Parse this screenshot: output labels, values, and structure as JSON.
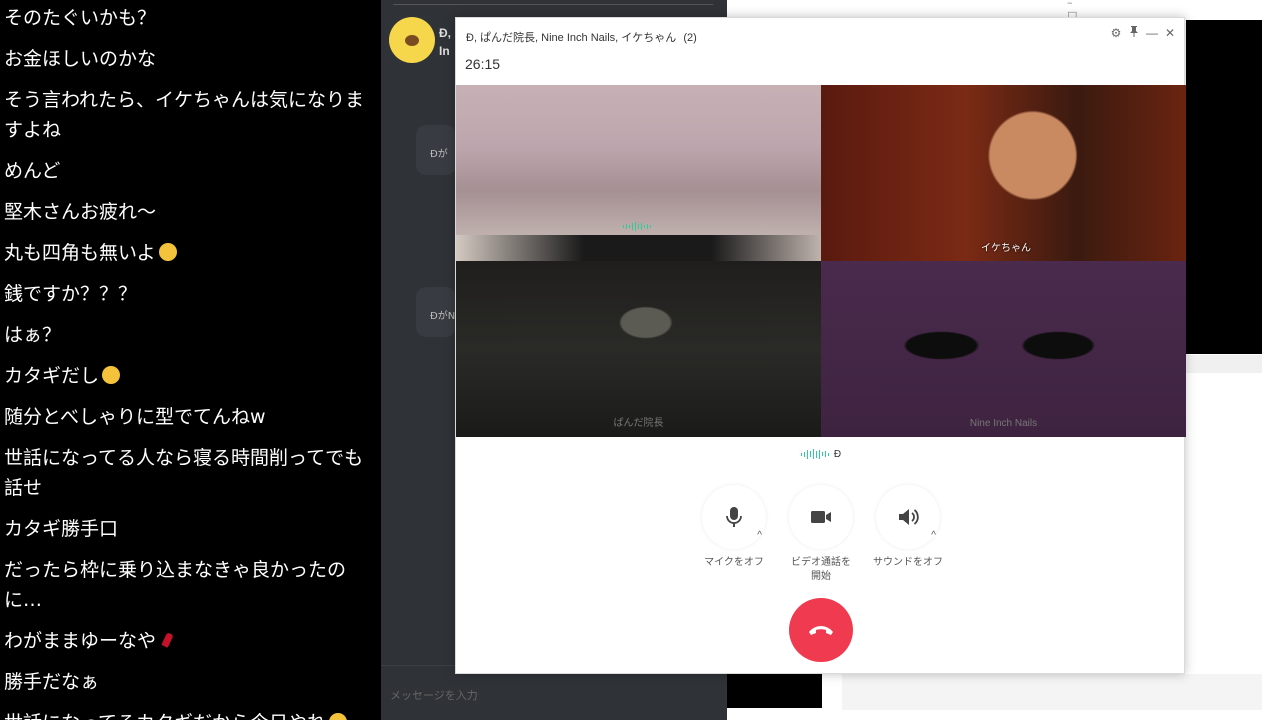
{
  "chat_overlay": {
    "messages": [
      "そのたぐいかも？",
      "お金ほしいのかな",
      "そう言われたら、イケちゃんは気になりますよね",
      "めんど",
      "堅木さんお疲れ～",
      "丸も四角も無いよ",
      "銭ですか？？？",
      "はぁ？",
      "カタギだし",
      "随分とべしゃりに型でてんねw",
      "世話になってる人なら寝る時間削ってでも話せ",
      "カタギ勝手口",
      "だったら枠に乗り込まなきゃ良かったのに…",
      "わがままゆーなや",
      "勝手だなぁ",
      "世話になってるカタギだから今日やれ"
    ]
  },
  "messenger_bg": {
    "header_name_1": "Đ,",
    "header_name_2": "In",
    "sys_msg_1": "Đが",
    "sys_msg_2": "ĐがN",
    "input_placeholder": "メッセージを入力"
  },
  "call_window": {
    "title": "Đ, ぱんだ院長, Nine Inch Nails, イケちゃん",
    "participant_count": "(2)",
    "timer": "26:15",
    "controls": {
      "settings_icon": "⚙",
      "pin_icon": "📌",
      "minimize": "—",
      "close": "✕"
    },
    "participants": [
      {
        "name": "Đ"
      },
      {
        "name": "イケちゃん"
      },
      {
        "name": "ぱんだ院長"
      },
      {
        "name": "Nine Inch Nails"
      }
    ],
    "speaking_name": "Đ",
    "buttons": {
      "mic_label": "マイクをオフ",
      "video_label_line1": "ビデオ通話を",
      "video_label_line2": "開始",
      "sound_label": "サウンドをオフ",
      "caret": "^"
    },
    "colors": {
      "end_call": "#ef3a50",
      "voice_indicator": "#2ecc9a"
    }
  }
}
